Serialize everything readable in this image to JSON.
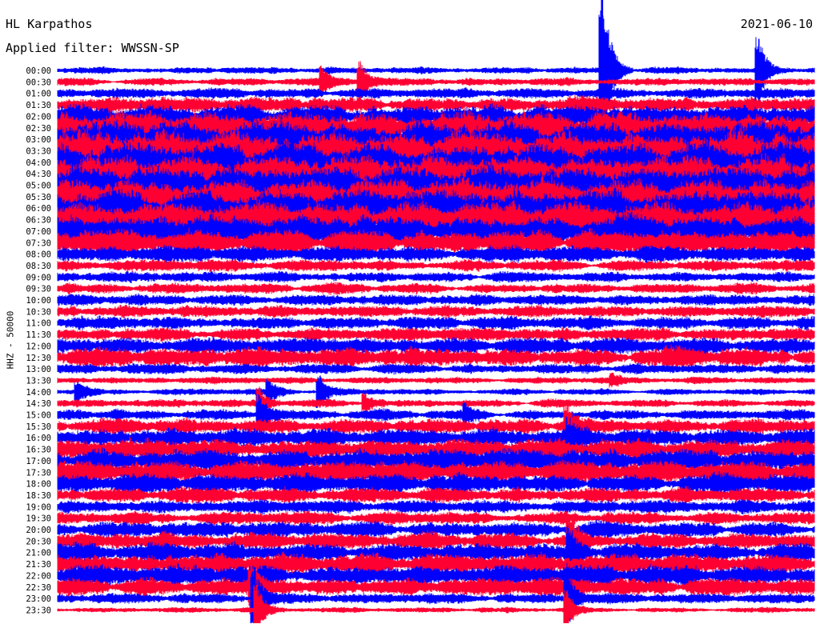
{
  "header": {
    "station": "HL Karpathos",
    "filter": "Applied filter: WWSSN-SP",
    "date": "2021-06-10"
  },
  "chart_data": {
    "type": "line",
    "chart_kind": "helicorder",
    "ylabel": "HHZ - 50000",
    "minutes_per_line": 30,
    "colors": [
      "#0000ff",
      "#ff0033"
    ],
    "rows": [
      "00:00",
      "00:30",
      "01:00",
      "01:30",
      "02:00",
      "02:30",
      "03:00",
      "03:30",
      "04:00",
      "04:30",
      "05:00",
      "05:30",
      "06:00",
      "06:30",
      "07:00",
      "07:30",
      "08:00",
      "08:30",
      "09:00",
      "09:30",
      "10:00",
      "10:30",
      "11:00",
      "11:30",
      "12:00",
      "12:30",
      "13:00",
      "13:30",
      "14:00",
      "14:30",
      "15:00",
      "15:30",
      "16:00",
      "16:30",
      "17:00",
      "17:30",
      "18:00",
      "18:30",
      "19:00",
      "19:30",
      "20:00",
      "20:30",
      "21:00",
      "21:30",
      "22:00",
      "22:30",
      "23:00",
      "23:30"
    ],
    "noise_level": [
      0.5,
      0.6,
      0.8,
      1.2,
      1.8,
      2.4,
      2.8,
      3.0,
      3.0,
      3.0,
      2.9,
      2.8,
      2.8,
      2.8,
      2.4,
      2.0,
      1.2,
      0.9,
      0.8,
      0.8,
      0.9,
      0.9,
      1.0,
      1.0,
      1.3,
      1.5,
      0.8,
      0.5,
      0.5,
      0.6,
      0.8,
      1.2,
      1.4,
      1.6,
      1.8,
      1.8,
      1.5,
      1.2,
      1.0,
      1.0,
      1.2,
      1.3,
      1.5,
      1.6,
      1.6,
      1.4,
      0.8,
      0.4
    ],
    "events": [
      {
        "row": 0,
        "minute": 21.6,
        "amplitude": 15
      },
      {
        "row": 0,
        "minute": 27.8,
        "amplitude": 5
      },
      {
        "row": 1,
        "minute": 10.5,
        "amplitude": 2
      },
      {
        "row": 1,
        "minute": 12.0,
        "amplitude": 3
      },
      {
        "row": 27,
        "minute": 22.0,
        "amplitude": 0.8
      },
      {
        "row": 28,
        "minute": 0.8,
        "amplitude": 1.5
      },
      {
        "row": 28,
        "minute": 8.4,
        "amplitude": 1.6
      },
      {
        "row": 28,
        "minute": 10.4,
        "amplitude": 2.5
      },
      {
        "row": 29,
        "minute": 8.0,
        "amplitude": 2
      },
      {
        "row": 29,
        "minute": 12.2,
        "amplitude": 1.4
      },
      {
        "row": 30,
        "minute": 8.0,
        "amplitude": 3
      },
      {
        "row": 30,
        "minute": 16.2,
        "amplitude": 1.2
      },
      {
        "row": 31,
        "minute": 20.2,
        "amplitude": 3
      },
      {
        "row": 32,
        "minute": 20.3,
        "amplitude": 2
      },
      {
        "row": 41,
        "minute": 20.3,
        "amplitude": 4
      },
      {
        "row": 42,
        "minute": 20.3,
        "amplitude": 3
      },
      {
        "row": 45,
        "minute": 7.7,
        "amplitude": 3
      },
      {
        "row": 46,
        "minute": 7.8,
        "amplitude": 5
      },
      {
        "row": 47,
        "minute": 7.9,
        "amplitude": 4
      },
      {
        "row": 46,
        "minute": 20.2,
        "amplitude": 5
      },
      {
        "row": 47,
        "minute": 20.2,
        "amplitude": 3
      }
    ]
  }
}
